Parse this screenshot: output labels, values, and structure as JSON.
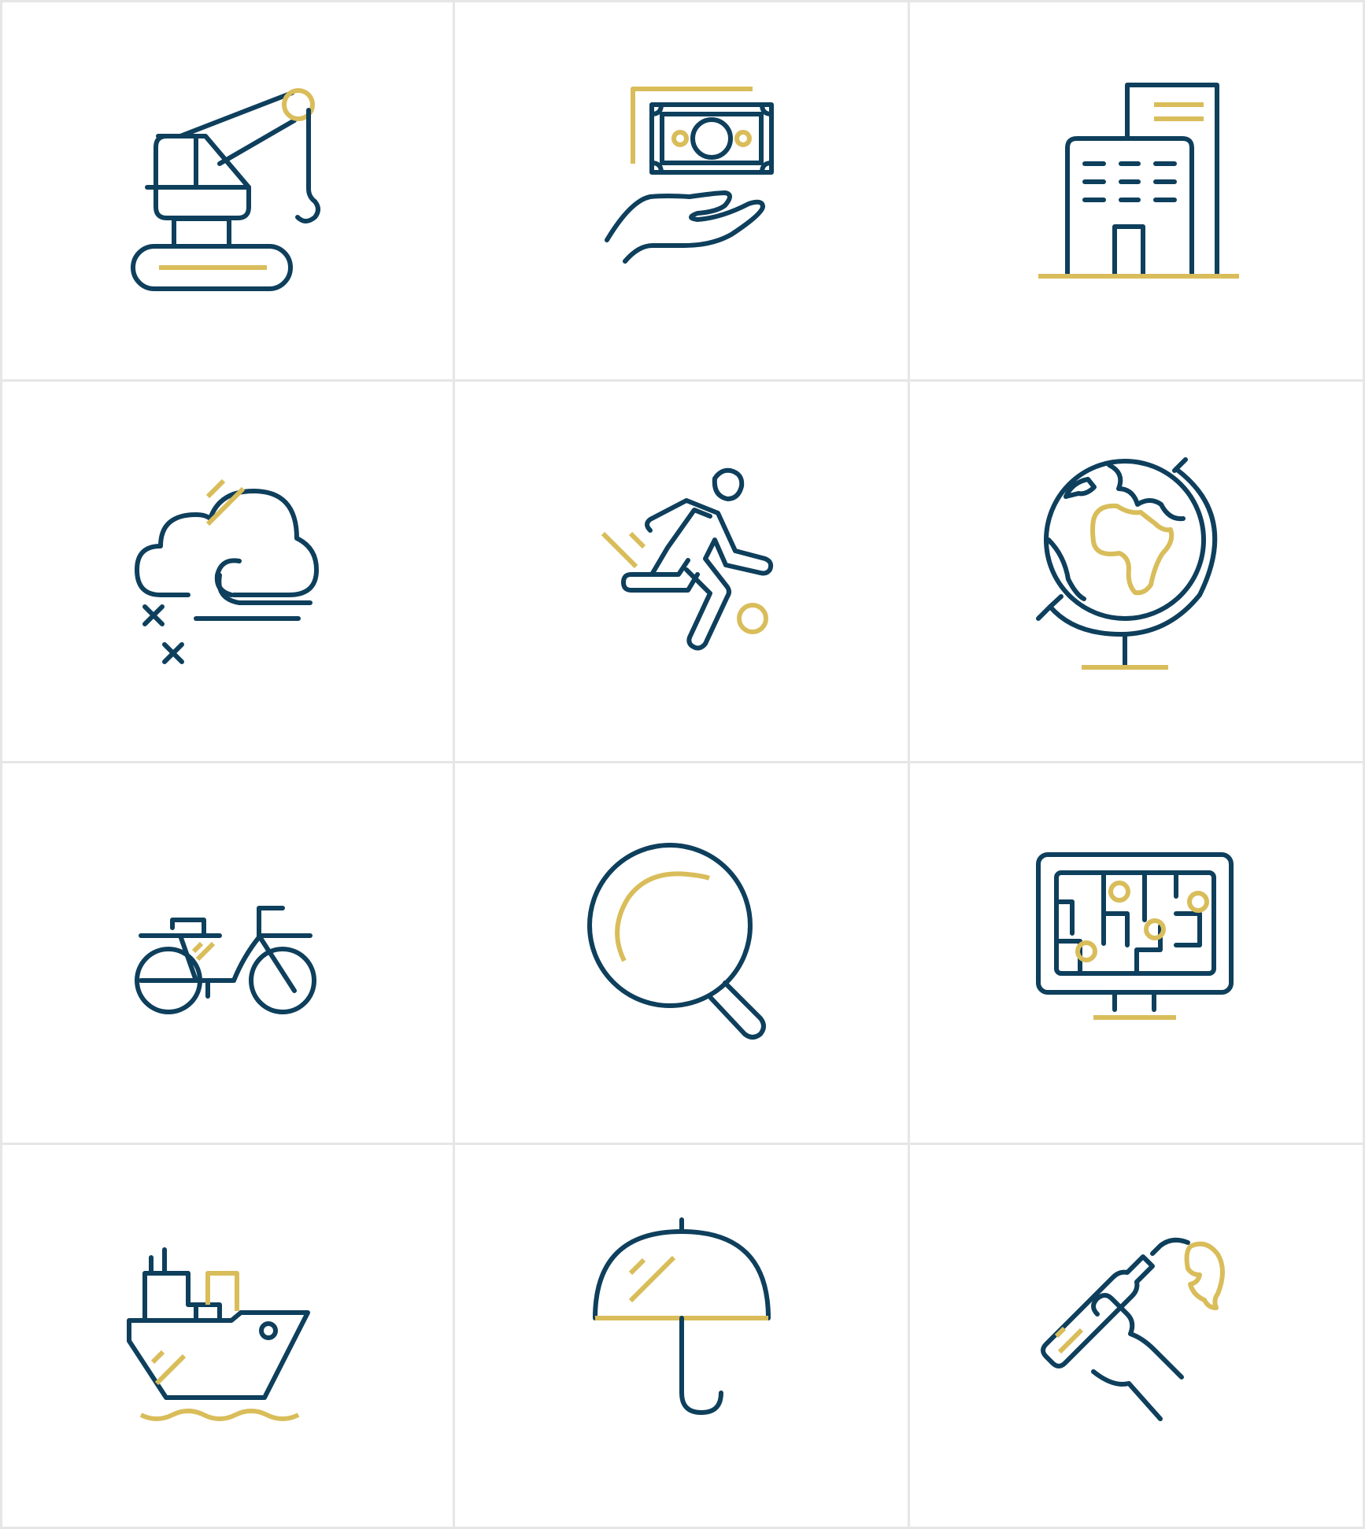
{
  "colors": {
    "navy": "#0e3f5c",
    "gold": "#d9bd5a",
    "grid_line": "#e6e6e6",
    "background": "#ffffff"
  },
  "icons": [
    {
      "name": "crane-icon"
    },
    {
      "name": "money-in-hand-icon"
    },
    {
      "name": "office-building-icon"
    },
    {
      "name": "storm-cloud-icon"
    },
    {
      "name": "running-person-icon"
    },
    {
      "name": "globe-icon"
    },
    {
      "name": "motorcycle-icon"
    },
    {
      "name": "magnifying-glass-icon"
    },
    {
      "name": "monitor-map-icon"
    },
    {
      "name": "cargo-ship-icon"
    },
    {
      "name": "umbrella-icon"
    },
    {
      "name": "broken-bottle-icon"
    }
  ]
}
